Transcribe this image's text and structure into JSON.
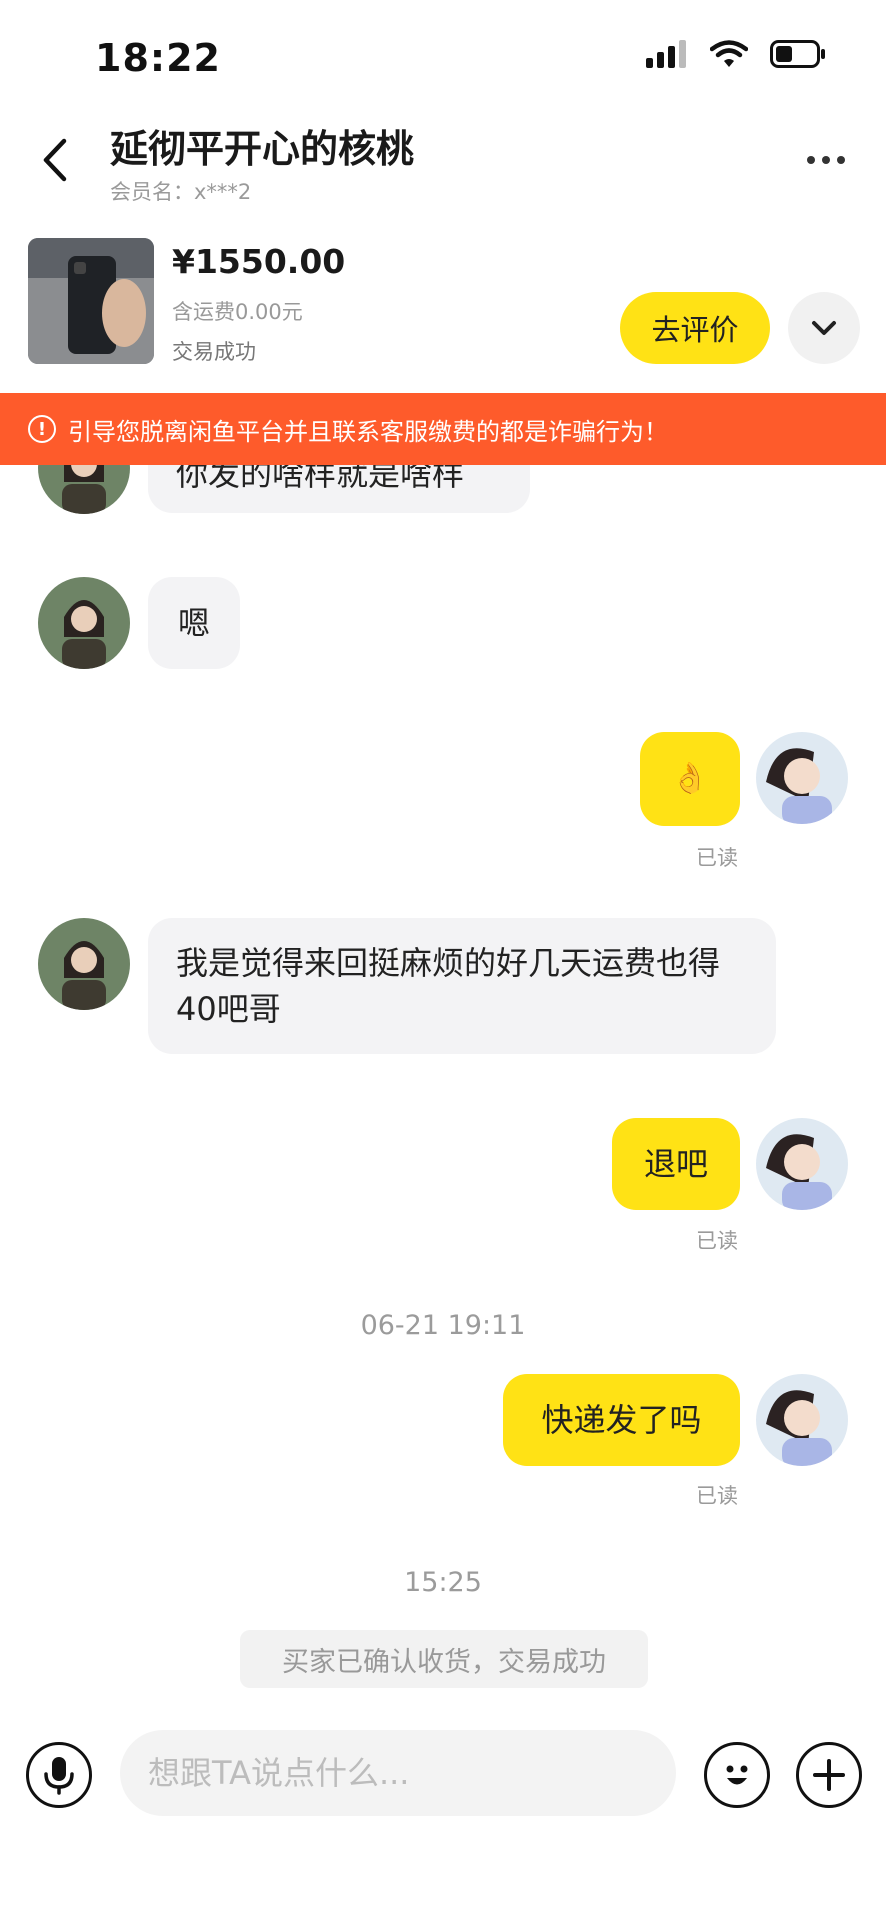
{
  "status_bar": {
    "time": "18:22"
  },
  "header": {
    "title": "延彻平开心的核桃",
    "member_label": "会员名：x***2"
  },
  "product": {
    "price": "¥1550.00",
    "shipping": "含运费0.00元",
    "status": "交易成功",
    "review_button": "去评价"
  },
  "warning": {
    "text": "引导您脱离闲鱼平台并且联系客服缴费的都是诈骗行为！"
  },
  "messages": [
    {
      "side": "left",
      "text": "你发的啥样就是啥样"
    },
    {
      "side": "left",
      "text": "嗯"
    },
    {
      "side": "right",
      "text": "👌",
      "read": "已读"
    },
    {
      "side": "left",
      "text": "我是觉得来回挺麻烦的好几天运费也得40吧哥"
    },
    {
      "side": "right",
      "text": "退吧",
      "read": "已读"
    },
    {
      "timestamp": "06-21 19:11"
    },
    {
      "side": "right",
      "text": "快递发了吗",
      "read": "已读"
    },
    {
      "timestamp": "15:25"
    }
  ],
  "system_message": "买家已确认收货，交易成功",
  "input": {
    "placeholder": "想跟TA说点什么..."
  }
}
